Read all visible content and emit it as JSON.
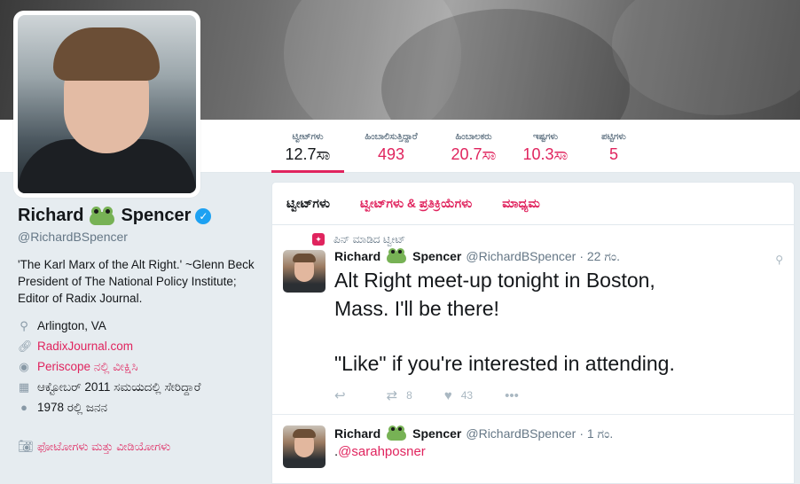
{
  "stats": [
    {
      "label": "ಟ್ವೀಟ್‌ಗಳು",
      "value": "12.7ಸಾ",
      "active": true
    },
    {
      "label": "ಹಿಂಬಾಲಿಸುತ್ತಿದ್ದಾರೆ",
      "value": "493"
    },
    {
      "label": "ಹಿಂಬಾಲಕರು",
      "value": "20.7ಸಾ"
    },
    {
      "label": "ಇಷ್ಟಗಳು",
      "value": "10.3ಸಾ"
    },
    {
      "label": "ಪಟ್ಟಿಗಳು",
      "value": "5"
    }
  ],
  "profile": {
    "first_name": "Richard",
    "last_name": "Spencer",
    "verified_glyph": "✓",
    "handle": "@RichardBSpencer",
    "bio": "'The Karl Marx of the Alt Right.' ~Glenn Beck President of The National Policy Institute; Editor of Radix Journal.",
    "location": "Arlington, VA",
    "website": "RadixJournal.com",
    "periscope": "Periscope ನಲ್ಲಿ ವೀಕ್ಷಿಸಿ",
    "joined": "ಆಕ್ಟೋಬರ್ 2011 ಸಮಯದಲ್ಲಿ ಸೇರಿದ್ದಾರೆ",
    "born": "1978 ರಲ್ಲಿ ಜನನ",
    "photos_link": "ಫೋಟೋಗಳು ಮತ್ತು ವೀಡಿಯೋಗಳು"
  },
  "tabs": [
    "ಟ್ವೀಟ್‌ಗಳು",
    "ಟ್ವೀಟ್‌ಗಳು & ಪ್ರತಿಕ್ರಿಯೆಗಳು",
    "ಮಾಧ್ಯಮ"
  ],
  "tweets": [
    {
      "pinned_label": "ಪಿನ್ ಮಾಡಿದ ಟ್ವೀಟ್",
      "name_first": "Richard",
      "name_last": "Spencer",
      "handle": "@RichardBSpencer",
      "time": "· 22 ಗಂ.",
      "line1": "Alt Right meet-up tonight in Boston,",
      "line2": "Mass. I'll be there!",
      "line3": "\"Like\" if you're interested in attending.",
      "retweets": "8",
      "likes": "43"
    },
    {
      "name_first": "Richard",
      "name_last": "Spencer",
      "handle": "@RichardBSpencer",
      "time": "· 1 ಗಂ.",
      "prefix": ".",
      "mention": "@sarahposner"
    }
  ],
  "icons": {
    "location": "map-pin-icon",
    "link": "link-icon",
    "periscope": "periscope-icon",
    "calendar": "calendar-icon",
    "birthday": "balloon-icon",
    "camera": "camera-icon",
    "reply": "reply-icon",
    "retweet": "retweet-icon",
    "like": "heart-icon",
    "more": "more-icon"
  },
  "colors": {
    "accent": "#e0245e",
    "verified": "#1da1f2",
    "background": "#e6ecf0"
  }
}
